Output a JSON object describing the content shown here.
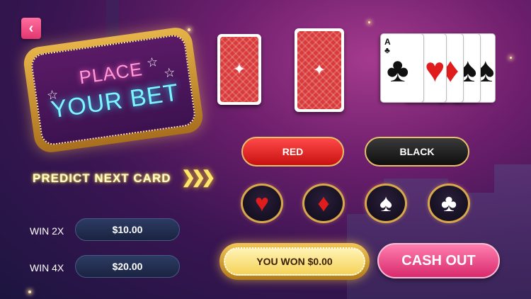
{
  "header": {
    "back_icon": "chevron-left-icon"
  },
  "sign": {
    "line1": "PLACE",
    "line2": "YOUR BET"
  },
  "predict": {
    "label": "PREDICT NEXT CARD",
    "arrows": "❯❯❯"
  },
  "wins": [
    {
      "label": "WIN 2X",
      "value": "$10.00"
    },
    {
      "label": "WIN 4X",
      "value": "$20.00"
    }
  ],
  "color_buttons": {
    "red": "RED",
    "black": "BLACK"
  },
  "suits": [
    {
      "name": "heart",
      "glyph": "♥",
      "color": "#e01c1c"
    },
    {
      "name": "diamond",
      "glyph": "♦",
      "color": "#e01c1c"
    },
    {
      "name": "spade",
      "glyph": "♠",
      "color": "#ffffff"
    },
    {
      "name": "club",
      "glyph": "♣",
      "color": "#ffffff"
    }
  ],
  "hand": {
    "card_rank": "A",
    "card_suits": [
      "♣",
      "♥",
      "♦",
      "♠",
      "♠"
    ]
  },
  "status": {
    "won_text": "YOU WON $0.00"
  },
  "actions": {
    "cash_out": "CASH OUT"
  },
  "colors": {
    "red": "#e01c1c",
    "gold": "#e8c06a",
    "pink": "#ff7eb0"
  }
}
